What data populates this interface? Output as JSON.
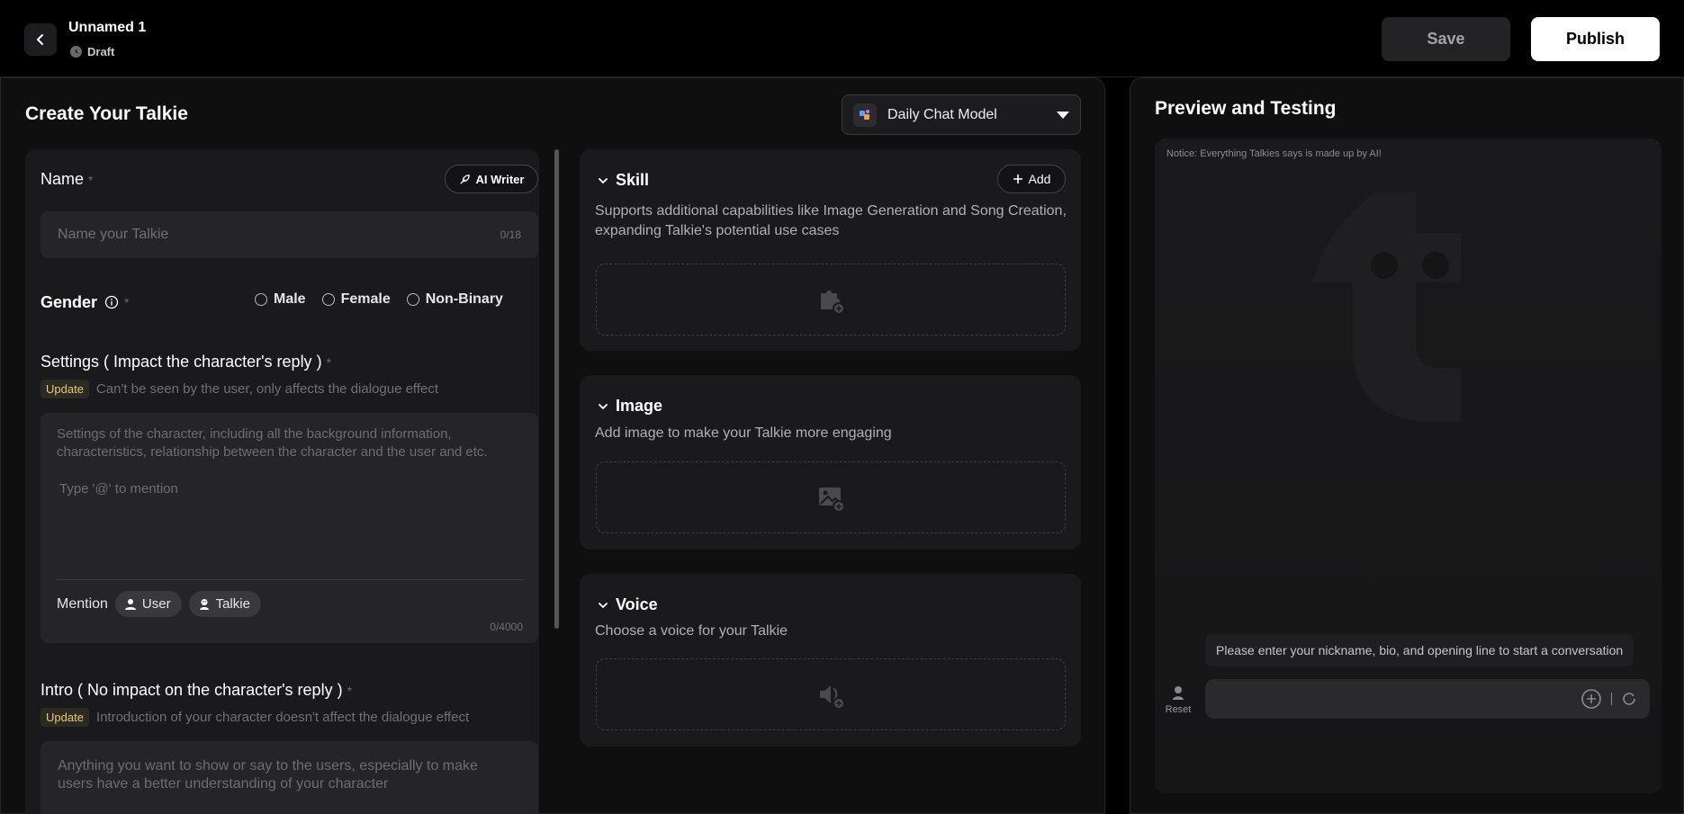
{
  "header": {
    "draft_name": "Unnamed 1",
    "status": "Draft",
    "save_label": "Save",
    "publish_label": "Publish"
  },
  "editor": {
    "title": "Create Your Talkie",
    "model": {
      "selected": "Daily Chat Model"
    }
  },
  "form": {
    "name": {
      "label": "Name",
      "required_mark": "*",
      "ai_writer_label": "AI Writer",
      "placeholder": "Name your Talkie",
      "counter": "0/18"
    },
    "gender": {
      "label": "Gender",
      "required_mark": "*",
      "options": [
        "Male",
        "Female",
        "Non-Binary"
      ]
    },
    "settings": {
      "label": "Settings ( Impact the character's reply )",
      "required_mark": "*",
      "tag": "Update",
      "hint": "Can't be seen by the user, only affects the dialogue effect",
      "placeholder": "Settings of the character, including all the background information, characteristics, relationship between the character and the user and etc.",
      "mention_hint": "Type '@' to mention",
      "mention_label": "Mention",
      "chips": [
        "User",
        "Talkie"
      ],
      "counter": "0/4000"
    },
    "intro": {
      "label": "Intro ( No impact on the character's reply )",
      "required_mark": "*",
      "tag": "Update",
      "hint": "Introduction of your character doesn't affect the dialogue effect",
      "placeholder": "Anything you want to show or say to the users, especially to make users have a better understanding of your character"
    }
  },
  "sections": {
    "skill": {
      "title": "Skill",
      "add_label": "Add",
      "description": "Supports additional capabilities like Image Generation and Song Creation, expanding Talkie's potential use cases"
    },
    "image": {
      "title": "Image",
      "description": "Add image to make your Talkie more engaging"
    },
    "voice": {
      "title": "Voice",
      "description": "Choose a voice for your Talkie"
    }
  },
  "preview": {
    "title": "Preview and Testing",
    "notice": "Notice: Everything Talkies says is made up by AI!",
    "prompt": "Please enter your nickname, bio, and opening line to start a conversation",
    "reset_label": "Reset",
    "input_value": ""
  },
  "colors": {
    "background": "#000000",
    "panel": "#0f0f10",
    "card": "#1a1a1c",
    "input": "#252527",
    "accent_tag": "#e8c979"
  },
  "icons": [
    "chevron-left-icon",
    "clock-icon",
    "feather-pen-icon",
    "info-icon",
    "user-icon",
    "talkie-icon",
    "chevron-down-icon",
    "plus-icon",
    "puzzle-add-icon",
    "image-add-icon",
    "speaker-add-icon",
    "talkie-logo-watermark",
    "reset-icon",
    "plus-circle-icon",
    "refresh-icon"
  ]
}
